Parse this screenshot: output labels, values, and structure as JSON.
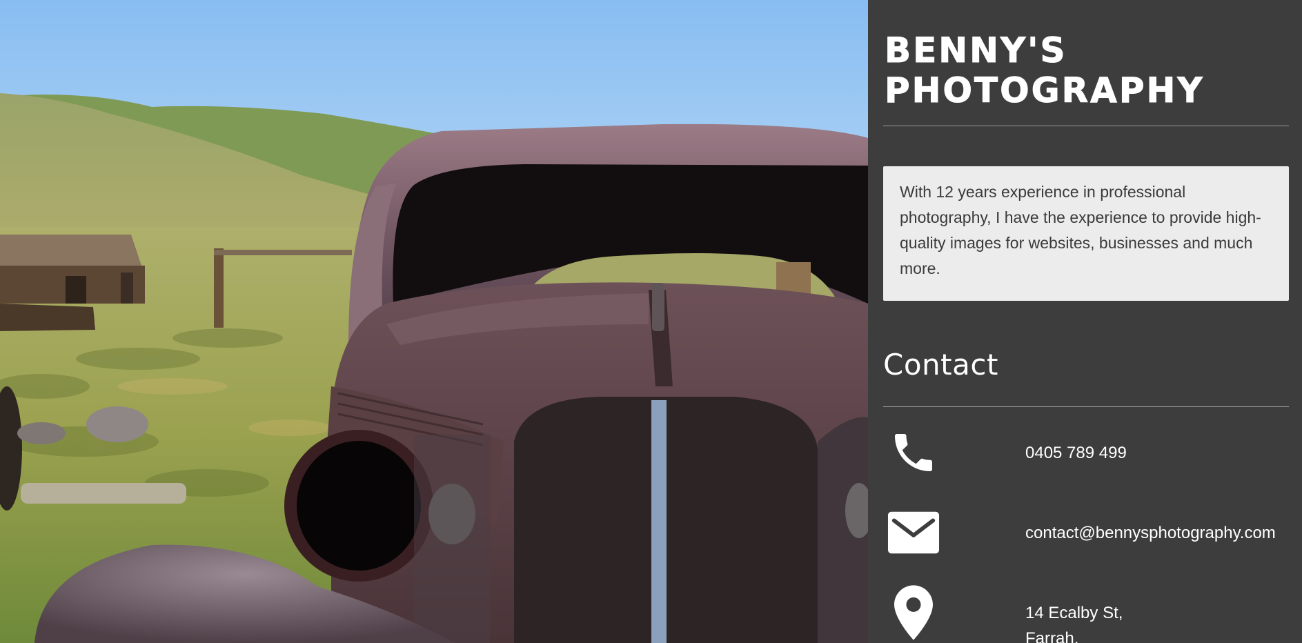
{
  "brand": {
    "line1": "BENNY'S",
    "line2": "PHOTOGRAPHY"
  },
  "about": {
    "text": "With 12 years experience in professional photography, I have the experience to provide high-quality images for websites, businesses and much more."
  },
  "contact": {
    "heading": "Contact",
    "items": [
      {
        "icon": "phone-icon",
        "value": "0405 789 499"
      },
      {
        "icon": "envelope-icon",
        "value": "contact@bennysphotography.com"
      },
      {
        "icon": "map-pin-icon",
        "lines": [
          "14 Ecalby St,",
          "Farrah,"
        ]
      }
    ]
  },
  "colors": {
    "sidebar_bg": "#3d3d3d",
    "about_bg": "#ececec",
    "text_light": "#ffffff",
    "text_dark": "#3a3a3a",
    "rule": "#9a9a9a"
  }
}
